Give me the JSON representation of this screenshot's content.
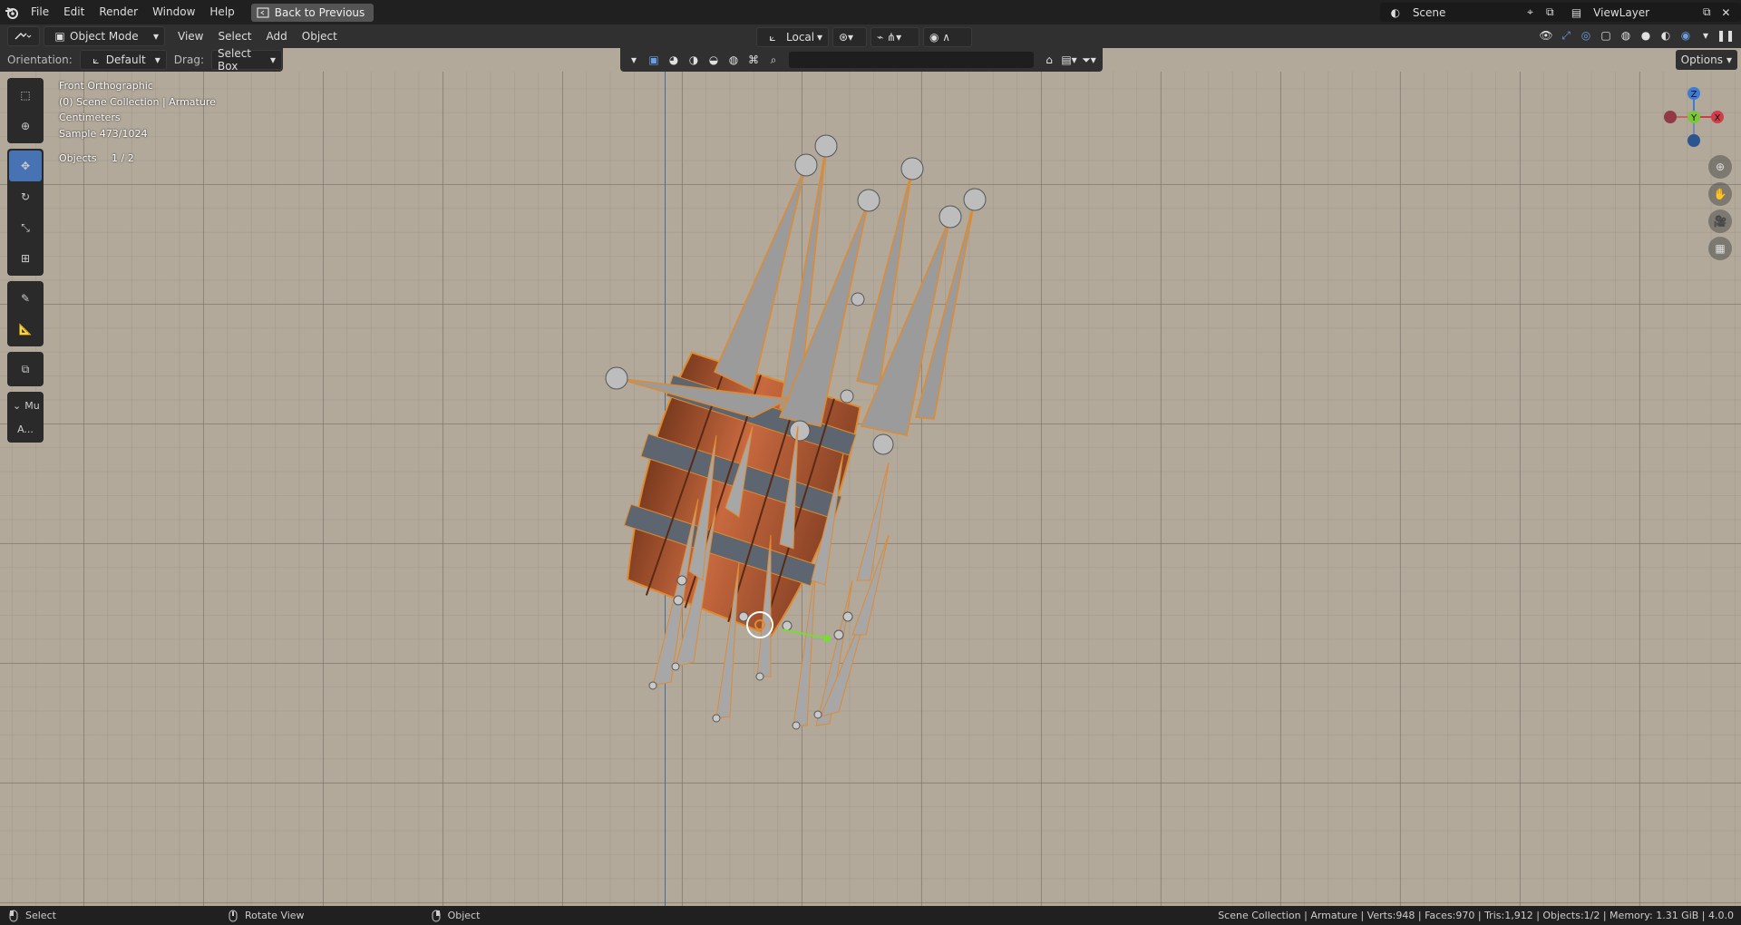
{
  "topbar": {
    "menus": [
      "File",
      "Edit",
      "Render",
      "Window",
      "Help"
    ],
    "back_button": "Back to Previous",
    "scene": "Scene",
    "view_layer": "ViewLayer"
  },
  "header": {
    "mode": "Object Mode",
    "menus": [
      "View",
      "Select",
      "Add",
      "Object"
    ],
    "transform_pivot": "Local"
  },
  "tool_header": {
    "orientation_label": "Orientation:",
    "orientation_value": "Default",
    "drag_label": "Drag:",
    "drag_value": "Select Box"
  },
  "options_label": "Options",
  "viewport_info": {
    "view": "Front Orthographic",
    "collection": "(0) Scene Collection | Armature",
    "units": "Centimeters",
    "sample": "Sample 473/1024",
    "objects_label": "Objects",
    "objects_count": "1 / 2"
  },
  "sidebar_panel": {
    "label": "Mu",
    "button": "A..."
  },
  "gizmo": {
    "z": "Z",
    "y": "Y",
    "x": "X"
  },
  "statusbar": {
    "select": "Select",
    "rotate": "Rotate View",
    "object": "Object",
    "stats": "Scene Collection | Armature | Verts:948 | Faces:970 | Tris:1,912 | Objects:1/2 | Memory: 1.31 GiB | 4.0.0"
  }
}
